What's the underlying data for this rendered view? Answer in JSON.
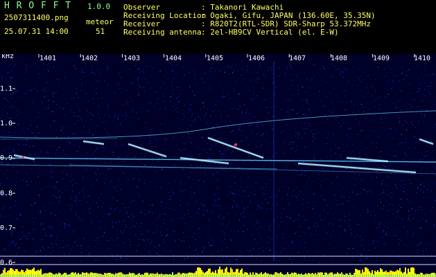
{
  "app": {
    "name": "H R O F F T",
    "version": "1.0.0"
  },
  "file": {
    "filename": "2507311400.png",
    "datetime": "25.07.31 14:00"
  },
  "counter": {
    "label": "meteor",
    "value": "51"
  },
  "info": {
    "observer_label": "Observer",
    "observer_value": ": Takanori Kawachi",
    "location_label": "Receiving Location",
    "location_value": ": Ogaki, Gifu, JAPAN (136.60E, 35.35N)",
    "receiver_label": "Receiver",
    "receiver_value": ": R820T2(RTL-SDR) SDR-Sharp 53.372MHz",
    "antenna_label": "Receiving antenna",
    "antenna_value": ": 2el-HB9CV Vertical (el. E-W)"
  },
  "axis": {
    "unit": "kHz",
    "x_ticks": [
      "1401",
      "1402",
      "1403",
      "1404",
      "1405",
      "1406",
      "1407",
      "1408",
      "1409",
      "1410"
    ],
    "y_ticks": [
      "1.1",
      "1.0",
      "0.9",
      "0.8",
      "0.7",
      "0.6"
    ]
  },
  "colors": {
    "background": "#000028",
    "noise": "#1a3cff",
    "trace": "#5fd0ff",
    "meteor_head": "#ff3366",
    "bottom_band": "#ffff00"
  }
}
